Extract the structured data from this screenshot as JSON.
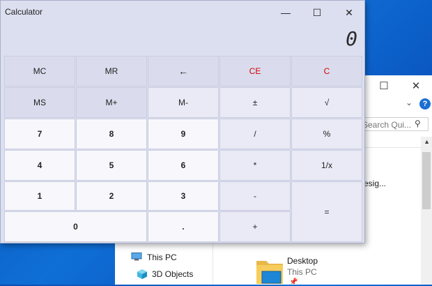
{
  "explorer": {
    "search_placeholder": "Search Qui...",
    "partial_text": "esig...",
    "nav": [
      {
        "label": "This PC"
      },
      {
        "label": "3D Objects"
      }
    ],
    "desktop_item": {
      "title": "Desktop",
      "subtitle": "This PC"
    },
    "help_label": "?"
  },
  "calculator": {
    "title": "Calculator",
    "display": "0",
    "keys": {
      "mc": "MC",
      "mr": "MR",
      "back": "←",
      "ce": "CE",
      "c": "C",
      "ms": "MS",
      "mplus": "M+",
      "mminus": "M-",
      "plusminus": "±",
      "sqrt": "√",
      "seven": "7",
      "eight": "8",
      "nine": "9",
      "divide": "/",
      "percent": "%",
      "four": "4",
      "five": "5",
      "six": "6",
      "multiply": "*",
      "reciprocal": "1/x",
      "one": "1",
      "two": "2",
      "three": "3",
      "minus": "-",
      "equals": "=",
      "zero": "0",
      "dot": ".",
      "plus": "+"
    },
    "accent_red": "#d40000"
  }
}
